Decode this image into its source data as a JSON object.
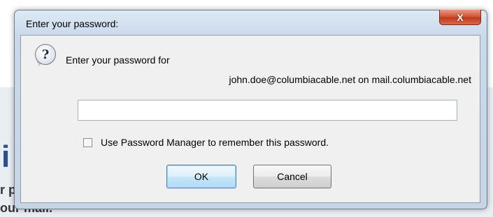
{
  "background": {
    "glyph": "i",
    "line1": "r p",
    "line2": "our mail."
  },
  "dialog": {
    "title": "Enter your password:",
    "close_glyph": "X",
    "icon": "question-icon",
    "prompt_line1": "Enter your password for",
    "prompt_line2": "john.doe@columbiacable.net on mail.columbiacable.net",
    "password_value": "",
    "checkbox_label": "Use Password Manager to remember this password.",
    "checkbox_checked": false,
    "ok_label": "OK",
    "cancel_label": "Cancel"
  }
}
